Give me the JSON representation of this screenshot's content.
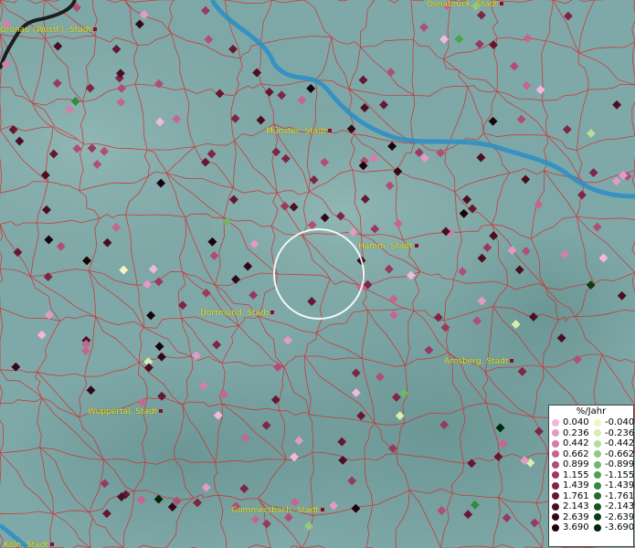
{
  "legend": {
    "unit": "%/Jahr",
    "positive": [
      {
        "label": "0.040",
        "color": "#f2b7dd"
      },
      {
        "label": "0.236",
        "color": "#e39ac4"
      },
      {
        "label": "0.442",
        "color": "#d57eaa"
      },
      {
        "label": "0.662",
        "color": "#c56690"
      },
      {
        "label": "0.899",
        "color": "#b04e76"
      },
      {
        "label": "1.155",
        "color": "#983a5e"
      },
      {
        "label": "1.439",
        "color": "#7e2646"
      },
      {
        "label": "1.761",
        "color": "#661833"
      },
      {
        "label": "2.143",
        "color": "#4c0e22"
      },
      {
        "label": "2.639",
        "color": "#330816"
      },
      {
        "label": "3.690",
        "color": "#1c030a"
      }
    ],
    "negative": [
      {
        "label": "-0.040",
        "color": "#f4f5c2"
      },
      {
        "label": "-0.236",
        "color": "#d8edb0"
      },
      {
        "label": "-0.442",
        "color": "#b6dd9a"
      },
      {
        "label": "-0.662",
        "color": "#93cb82"
      },
      {
        "label": "-0.899",
        "color": "#70b868"
      },
      {
        "label": "-1.155",
        "color": "#4ea24f"
      },
      {
        "label": "-1.439",
        "color": "#338a3a"
      },
      {
        "label": "-1.761",
        "color": "#1f6f2a"
      },
      {
        "label": "-2.143",
        "color": "#12551d"
      },
      {
        "label": "-2.639",
        "color": "#093c12"
      },
      {
        "label": "-3.690",
        "color": "#03250a"
      }
    ]
  },
  "cities": [
    {
      "label": "Osnabrück, Stadt"
    },
    {
      "label": "Gronau (Westf.), Stadt"
    },
    {
      "label": "Münster, Stadt"
    },
    {
      "label": "Hamm, Stadt"
    },
    {
      "label": "Dortmund, Stadt"
    },
    {
      "label": "Arnsberg, Stadt"
    },
    {
      "label": "Wuppertal, Stadt"
    },
    {
      "label": "Gummersbach, Stadt"
    },
    {
      "label": "Köln, Stadt"
    }
  ],
  "colors": {
    "river": "#2f8fc4",
    "boundaries": "#d22a2a",
    "terrain": "#7fa9a8",
    "label_text": "#e8e43a",
    "selection_ring": "#ffffff"
  }
}
